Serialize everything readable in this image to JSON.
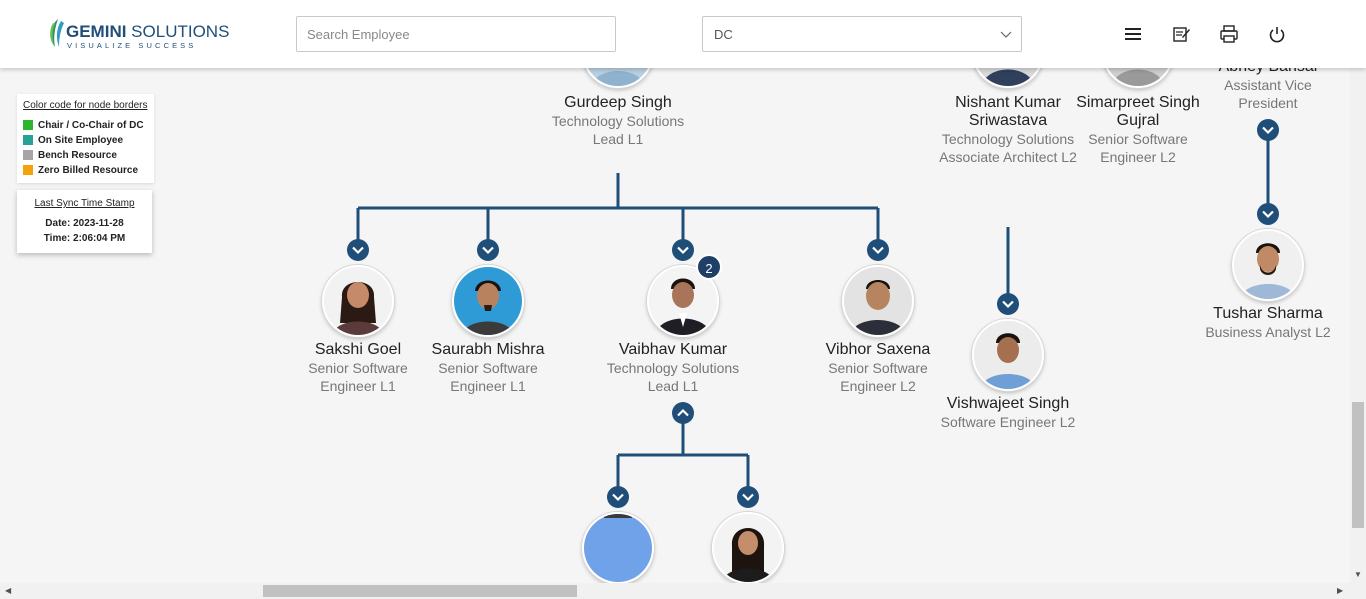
{
  "header": {
    "logo_main_bold": "GEMINI",
    "logo_main_rest": " SOLUTIONS",
    "logo_tagline": "VISUALIZE SUCCESS",
    "search_placeholder": "Search Employee",
    "department_selected": "DC",
    "icons": [
      "menu-icon",
      "notes-icon",
      "print-icon",
      "power-icon"
    ]
  },
  "legend": {
    "title": "Color code for node borders",
    "items": [
      {
        "label": "Chair / Co-Chair of DC",
        "color": "#2db52d"
      },
      {
        "label": "On Site Employee",
        "color": "#2aa198"
      },
      {
        "label": "Bench Resource",
        "color": "#a6a6a6"
      },
      {
        "label": "Zero Billed Resource",
        "color": "#f5a20a"
      }
    ]
  },
  "sync": {
    "title": "Last Sync Time Stamp",
    "date": "Date: 2023-11-28",
    "time": "Time: 2:06:04 PM"
  },
  "colors": {
    "accent": "#1f4e79",
    "connector": "#1f4e79"
  },
  "nodes": {
    "gurdeep": {
      "name": "Gurdeep Singh",
      "title": "Technology Solutions Lead L1"
    },
    "nishant": {
      "name": "Nishant Kumar Sriwastava",
      "title": "Technology Solutions Associate Architect L2"
    },
    "simarpreet": {
      "name": "Simarpreet Singh Gujral",
      "title": "Senior Software Engineer L2"
    },
    "abhey": {
      "name": "Abhey Bansal",
      "title": "Assistant Vice President"
    },
    "sakshi": {
      "name": "Sakshi Goel",
      "title": "Senior Software Engineer L1"
    },
    "saurabh": {
      "name": "Saurabh Mishra",
      "title": "Senior Software Engineer L1"
    },
    "vaibhav": {
      "name": "Vaibhav Kumar",
      "title": "Technology Solutions Lead L1",
      "badge": "2"
    },
    "vibhor": {
      "name": "Vibhor Saxena",
      "title": "Senior Software Engineer L2"
    },
    "vishwajeet": {
      "name": "Vishwajeet Singh",
      "title": "Software Engineer L2"
    },
    "tushar": {
      "name": "Tushar Sharma",
      "title": "Business Analyst L2"
    }
  }
}
